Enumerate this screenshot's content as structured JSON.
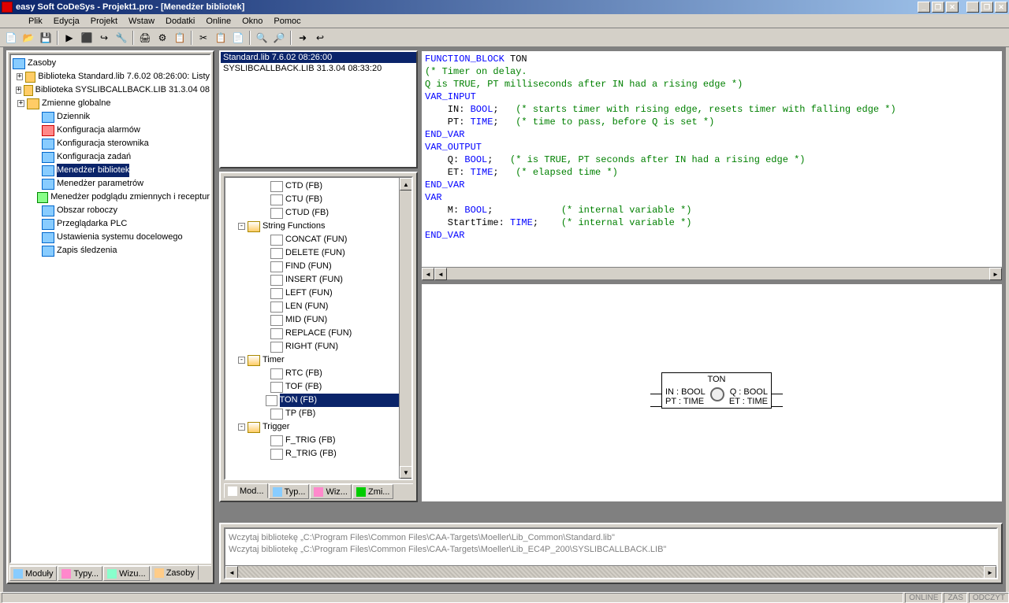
{
  "title": "easy Soft CoDeSys - Projekt1.pro - [Menedżer bibliotek]",
  "menu": [
    "Plik",
    "Edycja",
    "Projekt",
    "Wstaw",
    "Dodatki",
    "Online",
    "Okno",
    "Pomoc"
  ],
  "left_tree": {
    "header": "Zasoby",
    "items": [
      {
        "exp": "+",
        "icon": "folder-closed",
        "label": "Biblioteka Standard.lib 7.6.02 08:26:00: Listy",
        "ind": 0
      },
      {
        "exp": "+",
        "icon": "folder-closed",
        "label": "Biblioteka SYSLIBCALLBACK.LIB 31.3.04 08",
        "ind": 0
      },
      {
        "exp": "+",
        "icon": "folder-closed",
        "label": "Zmienne globalne",
        "ind": 0
      },
      {
        "icon": "special",
        "label": "Dziennik",
        "ind": 1
      },
      {
        "icon": "red",
        "label": "Konfiguracja alarmów",
        "ind": 1
      },
      {
        "icon": "special",
        "label": "Konfiguracja sterownika",
        "ind": 1
      },
      {
        "icon": "special",
        "label": "Konfiguracja zadań",
        "ind": 1
      },
      {
        "icon": "special",
        "label": "Menedżer bibliotek",
        "ind": 1,
        "sel": true
      },
      {
        "icon": "special",
        "label": "Menedżer parametrów",
        "ind": 1
      },
      {
        "icon": "green",
        "label": "Menedżer podglądu zmiennych i receptur",
        "ind": 1
      },
      {
        "icon": "special",
        "label": "Obszar roboczy",
        "ind": 1
      },
      {
        "icon": "special",
        "label": "Przeglądarka PLC",
        "ind": 1
      },
      {
        "icon": "special",
        "label": "Ustawienia systemu docelowego",
        "ind": 1
      },
      {
        "icon": "special",
        "label": "Zapis śledzenia",
        "ind": 1
      }
    ]
  },
  "left_tabs": [
    "Moduły",
    "Typy...",
    "Wizu...",
    "Zasoby"
  ],
  "liblist": [
    {
      "label": "Standard.lib 7.6.02 08:26:00",
      "sel": true
    },
    {
      "label": "SYSLIBCALLBACK.LIB 31.3.04 08:33:20"
    }
  ],
  "fbtree": [
    {
      "icon": "doc",
      "label": "CTD (FB)",
      "ind": 3
    },
    {
      "icon": "doc",
      "label": "CTU (FB)",
      "ind": 3
    },
    {
      "icon": "doc",
      "label": "CTUD (FB)",
      "ind": 3
    },
    {
      "exp": "-",
      "icon": "folder-open",
      "label": "String Functions",
      "ind": 1
    },
    {
      "icon": "doc",
      "label": "CONCAT (FUN)",
      "ind": 3
    },
    {
      "icon": "doc",
      "label": "DELETE (FUN)",
      "ind": 3
    },
    {
      "icon": "doc",
      "label": "FIND (FUN)",
      "ind": 3
    },
    {
      "icon": "doc",
      "label": "INSERT (FUN)",
      "ind": 3
    },
    {
      "icon": "doc",
      "label": "LEFT (FUN)",
      "ind": 3
    },
    {
      "icon": "doc",
      "label": "LEN (FUN)",
      "ind": 3
    },
    {
      "icon": "doc",
      "label": "MID (FUN)",
      "ind": 3
    },
    {
      "icon": "doc",
      "label": "REPLACE (FUN)",
      "ind": 3
    },
    {
      "icon": "doc",
      "label": "RIGHT (FUN)",
      "ind": 3
    },
    {
      "exp": "-",
      "icon": "folder-open",
      "label": "Timer",
      "ind": 1
    },
    {
      "icon": "doc",
      "label": "RTC (FB)",
      "ind": 3
    },
    {
      "icon": "doc",
      "label": "TOF (FB)",
      "ind": 3
    },
    {
      "icon": "doc",
      "label": "TON (FB)",
      "ind": 3,
      "sel": true
    },
    {
      "icon": "doc",
      "label": "TP (FB)",
      "ind": 3
    },
    {
      "exp": "-",
      "icon": "folder-open",
      "label": "Trigger",
      "ind": 1
    },
    {
      "icon": "doc",
      "label": "F_TRIG (FB)",
      "ind": 3
    },
    {
      "icon": "doc",
      "label": "R_TRIG (FB)",
      "ind": 3
    }
  ],
  "fb_tabs": [
    "Mod...",
    "Typ...",
    "Wiz...",
    "Zmi..."
  ],
  "code_lines": [
    [
      {
        "c": "blue",
        "t": "FUNCTION_BLOCK"
      },
      {
        "c": "black",
        "t": " TON"
      }
    ],
    [
      {
        "c": "green",
        "t": "(* Timer on delay."
      }
    ],
    [
      {
        "c": "green",
        "t": "Q is TRUE, PT milliseconds after IN had a rising edge *)"
      }
    ],
    [
      {
        "c": "blue",
        "t": "VAR_INPUT"
      }
    ],
    [
      {
        "c": "black",
        "t": "    IN: "
      },
      {
        "c": "blue",
        "t": "BOOL"
      },
      {
        "c": "black",
        "t": ";   "
      },
      {
        "c": "green",
        "t": "(* starts timer with rising edge, resets timer with falling edge *)"
      }
    ],
    [
      {
        "c": "black",
        "t": "    PT: "
      },
      {
        "c": "blue",
        "t": "TIME"
      },
      {
        "c": "black",
        "t": ";   "
      },
      {
        "c": "green",
        "t": "(* time to pass, before Q is set *)"
      }
    ],
    [
      {
        "c": "blue",
        "t": "END_VAR"
      }
    ],
    [
      {
        "c": "blue",
        "t": "VAR_OUTPUT"
      }
    ],
    [
      {
        "c": "black",
        "t": "    Q: "
      },
      {
        "c": "blue",
        "t": "BOOL"
      },
      {
        "c": "black",
        "t": ";   "
      },
      {
        "c": "green",
        "t": "(* is TRUE, PT seconds after IN had a rising edge *)"
      }
    ],
    [
      {
        "c": "black",
        "t": "    ET: "
      },
      {
        "c": "blue",
        "t": "TIME"
      },
      {
        "c": "black",
        "t": ";   "
      },
      {
        "c": "green",
        "t": "(* elapsed time *)"
      }
    ],
    [
      {
        "c": "blue",
        "t": "END_VAR"
      }
    ],
    [
      {
        "c": "blue",
        "t": "VAR"
      }
    ],
    [
      {
        "c": "black",
        "t": "    M: "
      },
      {
        "c": "blue",
        "t": "BOOL"
      },
      {
        "c": "black",
        "t": ";            "
      },
      {
        "c": "green",
        "t": "(* internal variable *)"
      }
    ],
    [
      {
        "c": "black",
        "t": "    StartTime: "
      },
      {
        "c": "blue",
        "t": "TIME"
      },
      {
        "c": "black",
        "t": ";    "
      },
      {
        "c": "green",
        "t": "(* internal variable *)"
      }
    ],
    [
      {
        "c": "blue",
        "t": "END_VAR"
      }
    ]
  ],
  "fb_block": {
    "title": "TON",
    "in1": "IN : BOOL",
    "in2": "PT : TIME",
    "out1": "Q : BOOL",
    "out2": "ET : TIME"
  },
  "messages": [
    "Wczytaj bibliotekę „C:\\Program Files\\Common Files\\CAA-Targets\\Moeller\\Lib_Common\\Standard.lib\"",
    "Wczytaj bibliotekę „C:\\Program Files\\Common Files\\CAA-Targets\\Moeller\\Lib_EC4P_200\\SYSLIBCALLBACK.LIB\""
  ],
  "status": [
    "ONLINE",
    "ZAS",
    "ODCZYT"
  ]
}
